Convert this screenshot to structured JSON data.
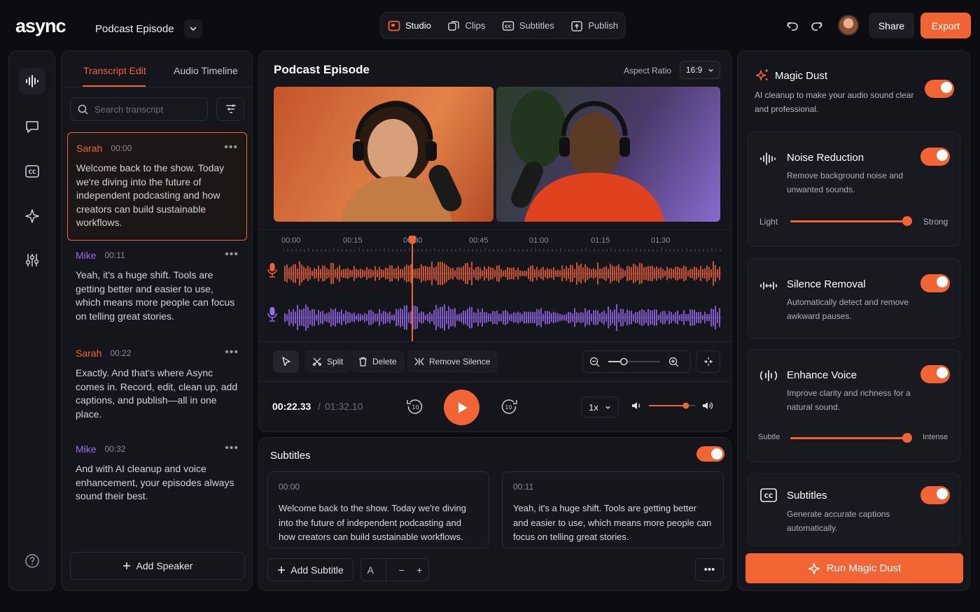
{
  "app": {
    "logo": "async",
    "project_title": "Podcast Episode"
  },
  "modes": [
    {
      "label": "Studio",
      "icon": "studio-icon",
      "active": true
    },
    {
      "label": "Clips",
      "icon": "clips-icon",
      "active": false
    },
    {
      "label": "Subtitles",
      "icon": "cc-icon",
      "active": false
    },
    {
      "label": "Publish",
      "icon": "publish-icon",
      "active": false
    }
  ],
  "header": {
    "share_label": "Share",
    "export_label": "Export"
  },
  "colors": {
    "accent": "#f26433",
    "speaker_sarah": "#f26433",
    "speaker_mike": "#9a6cf2",
    "background": "#0c0c11"
  },
  "transcript": {
    "tabs": [
      "Transcript Edit",
      "Audio Timeline"
    ],
    "search_placeholder": "Search transcript",
    "entries": [
      {
        "speaker": "Sarah",
        "time": "00:00",
        "text": "Welcome back to the show. Today we're diving into the future of independent podcasting and how creators can build sustainable workflows."
      },
      {
        "speaker": "Mike",
        "time": "00:11",
        "text": "Yeah, it's a huge shift. Tools are getting better and easier to use, which means more people can focus on telling great stories."
      },
      {
        "speaker": "Sarah",
        "time": "00:22",
        "text": "Exactly. And that's where Async comes in. Record, edit, clean up, add captions, and publish—all in one place."
      },
      {
        "speaker": "Mike",
        "time": "00:32",
        "text": "And with AI cleanup and voice enhancement, your episodes always sound their best."
      }
    ],
    "add_speaker_label": "Add Speaker"
  },
  "editor": {
    "title": "Podcast Episode",
    "aspect_label": "Aspect Ratio",
    "aspect_value": "16:9",
    "timeline_ticks": [
      "00:00",
      "00:15",
      "00:30",
      "00:45",
      "01:00",
      "01:15",
      "01:30"
    ],
    "playhead_time_fraction": 0.2925,
    "tools": {
      "split": "Split",
      "delete": "Delete",
      "remove_silence": "Remove Silence"
    },
    "zoom_level": 0.3,
    "current_time": "00:22.33",
    "time_separator": "/",
    "total_time": "01:32.10",
    "skip_back": "10",
    "skip_forward": "10",
    "speed": "1x",
    "volume_level": 0.8
  },
  "subtitles": {
    "title": "Subtitles",
    "enabled": true,
    "cards": [
      {
        "time": "00:00",
        "text": "Welcome back to the show. Today we're diving into the future of independent podcasting and how creators can build sustainable workflows."
      },
      {
        "time": "00:11",
        "text": "Yeah, it's a huge shift. Tools are getting better and easier to use, which means more people can focus on telling great stories."
      }
    ],
    "add_label": "Add Subtitle",
    "font_label": "A",
    "minus": "−",
    "plus": "+"
  },
  "magic": {
    "title": "Magic Dust",
    "desc": "AI cleanup to make your audio sound clear and professional.",
    "enabled": true,
    "cards": [
      {
        "title": "Noise Reduction",
        "desc": "Remove background noise and unwanted sounds.",
        "icon": "waveform-icon",
        "enabled": true,
        "slider": {
          "min_label": "Light",
          "max_label": "Strong",
          "value": 0.98
        }
      },
      {
        "title": "Silence Removal",
        "desc": "Automatically detect and remove awkward pauses.",
        "icon": "silence-icon",
        "enabled": true
      },
      {
        "title": "Enhance Voice",
        "desc": "Improve clarity and richness for a natural sound.",
        "icon": "voice-icon",
        "enabled": true,
        "slider": {
          "min_label": "Subtle",
          "max_label": "Intense",
          "value": 0.98
        }
      },
      {
        "title": "Subtitles",
        "desc": "Generate accurate captions automatically.",
        "icon": "cc-icon",
        "enabled": true
      }
    ],
    "run_label": "Run Magic Dust"
  }
}
